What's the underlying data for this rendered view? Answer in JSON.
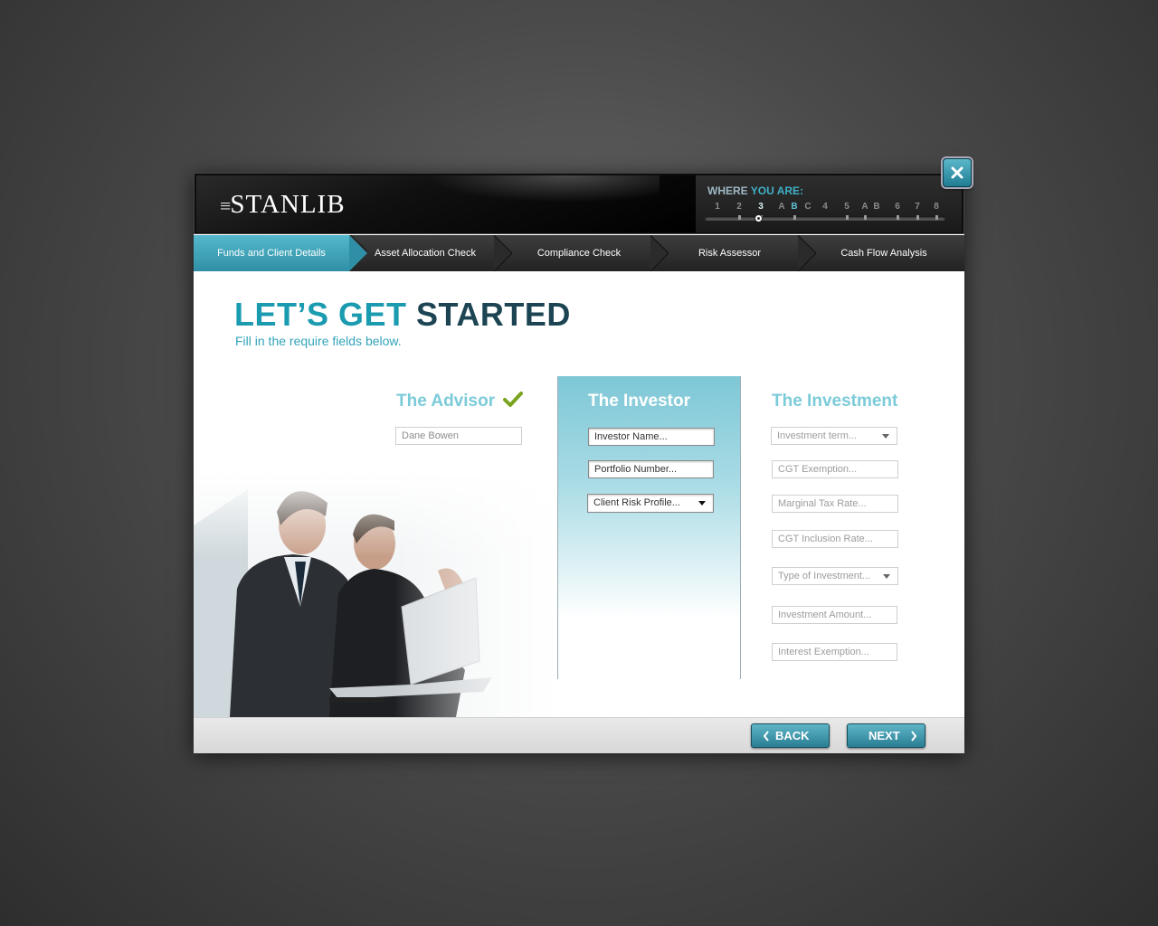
{
  "header": {
    "logo_text": "STANLIB",
    "where_label_1": "WHERE ",
    "where_label_2": "YOU ARE:",
    "steps": [
      "1",
      "2",
      "3",
      "A",
      "B",
      "C",
      "4",
      "5",
      "A",
      "B",
      "6",
      "7",
      "8"
    ],
    "current_step_index": 2,
    "current_sub_index": 4
  },
  "tabs": [
    {
      "label": "Funds and Client Details",
      "active": true
    },
    {
      "label": "Asset Allocation Check",
      "active": false
    },
    {
      "label": "Compliance Check",
      "active": false
    },
    {
      "label": "Risk Assessor",
      "active": false
    },
    {
      "label": "Cash Flow Analysis",
      "active": false
    }
  ],
  "main": {
    "title_part1": "LET’S GET ",
    "title_part2": "STARTED",
    "subtitle": "Fill in the require fields below."
  },
  "advisor": {
    "title": "The Advisor",
    "name_placeholder": "Dane Bowen"
  },
  "investor": {
    "title": "The Investor",
    "name_placeholder": "Investor Name...",
    "portfolio_placeholder": "Portfolio Number...",
    "risk_profile_select": "Client Risk Profile..."
  },
  "investment": {
    "title": "The Investment",
    "term_select": "Investment term...",
    "cgt_exemption": "CGT Exemption...",
    "marginal_tax": "Marginal Tax Rate...",
    "cgt_inclusion": "CGT Inclusion Rate...",
    "type_select": "Type of Investment...",
    "amount": "Investment Amount...",
    "interest_exemption": "Interest Exemption..."
  },
  "footer": {
    "back_label": "BACK",
    "next_label": "NEXT"
  },
  "colors": {
    "accent": "#1b9bb0",
    "dark_title": "#1c4452",
    "check": "#7aa31e"
  }
}
